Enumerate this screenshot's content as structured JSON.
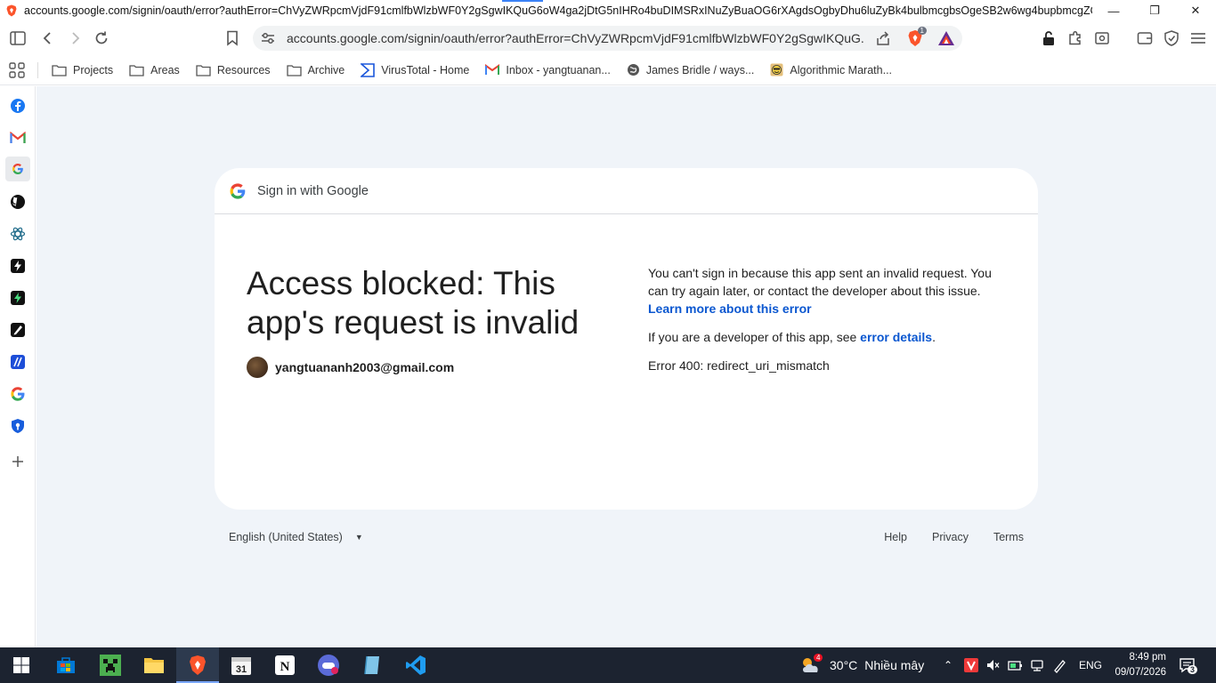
{
  "window": {
    "title": "accounts.google.com/signin/oauth/error?authError=ChVyZWRpcmVjdF91cmlfbWlzbWF0Y2gSgwIKQuG6oW4ga2jDtG5nIHRo4buDIMSRxINuZyBuaOG6rXAgdsOgbyDhu6luZyBk4bulbmcgbsOgeSB2w6wg4bupbmcgZOG7pW5nl..."
  },
  "toolbar": {
    "url": "accounts.google.com/signin/oauth/error?authError=ChVyZWRpcmVjdF91cmlfbWlzbWF0Y2gSgwIKQuG...",
    "shields_count": "1"
  },
  "bookmarks": [
    {
      "label": "Projects",
      "icon": "folder-icon"
    },
    {
      "label": "Areas",
      "icon": "folder-icon"
    },
    {
      "label": "Resources",
      "icon": "folder-icon"
    },
    {
      "label": "Archive",
      "icon": "folder-icon"
    },
    {
      "label": "VirusTotal - Home",
      "icon": "virustotal-icon"
    },
    {
      "label": "Inbox - yangtuanan...",
      "icon": "gmail-icon"
    },
    {
      "label": "James Bridle / ways...",
      "icon": "globe-icon"
    },
    {
      "label": "Algorithmic Marath...",
      "icon": "emoji-icon"
    }
  ],
  "card": {
    "header": "Sign in with Google",
    "headline": "Access blocked: This app's request is invalid",
    "email": "yangtuananh2003@gmail.com",
    "para1": "You can't sign in because this app sent an invalid request. You can try again later, or contact the developer about this issue.",
    "learn_more": "Learn more about this error",
    "dev_prefix": "If you are a developer of this app, see",
    "error_details": "error details",
    "dev_suffix": ".",
    "error_code": "Error 400: redirect_uri_mismatch"
  },
  "footer": {
    "language": "English (United States)",
    "help": "Help",
    "privacy": "Privacy",
    "terms": "Terms"
  },
  "taskbar": {
    "weather_temp": "30°C",
    "weather_desc": "Nhiều mây",
    "weather_badge": "4",
    "lang": "ENG",
    "time": "8:49 pm",
    "date": "09/07/2026",
    "notifications": "3"
  },
  "colors": {
    "link": "#0b57d0",
    "content_bg": "#f0f4f9",
    "taskbar_bg": "#1c2330"
  }
}
